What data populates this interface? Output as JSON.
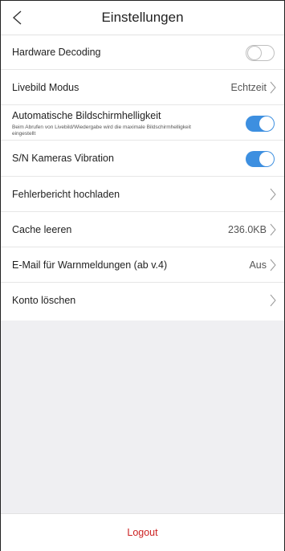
{
  "header": {
    "title": "Einstellungen",
    "back_icon": "chevron-left-icon"
  },
  "settings": {
    "hardware_decoding": {
      "label": "Hardware Decoding",
      "enabled": false
    },
    "livebild_modus": {
      "label": "Livebild Modus",
      "value": "Echtzeit"
    },
    "auto_brightness": {
      "label": "Automatische Bildschirmhelligkeit",
      "description": "Beim Abrufen von Livebild/Wiedergabe wird die maximale Bildschirmhelligkeit eingestellt",
      "enabled": true
    },
    "camera_vibration": {
      "label": "S/N Kameras Vibration",
      "enabled": true
    },
    "error_report": {
      "label": "Fehlerbericht hochladen"
    },
    "clear_cache": {
      "label": "Cache leeren",
      "value": "236.0KB"
    },
    "alert_email": {
      "label": "E-Mail für Warnmeldungen (ab v.4)",
      "value": "Aus"
    },
    "delete_account": {
      "label": "Konto löschen"
    }
  },
  "footer": {
    "logout_label": "Logout"
  },
  "colors": {
    "toggle_on": "#3d8fe0",
    "logout": "#cc2222",
    "background_gray": "#efeff2"
  }
}
